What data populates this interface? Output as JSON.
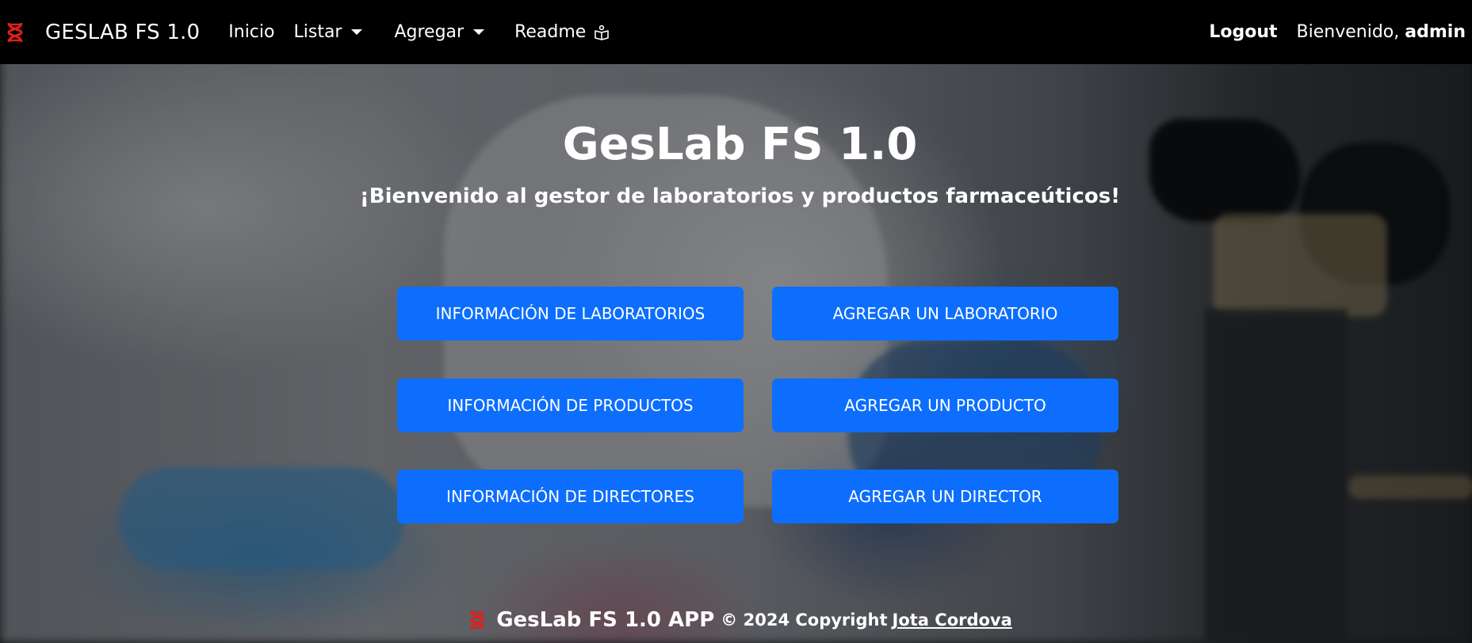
{
  "navbar": {
    "brand_icon": "dna-icon",
    "brand_title": "GESLAB FS 1.0",
    "items": {
      "inicio": "Inicio",
      "listar": "Listar",
      "agregar": "Agregar",
      "readme": "Readme"
    },
    "readme_icon": "book-icon",
    "logout": "Logout",
    "welcome_prefix": "Bienvenido,",
    "welcome_user": "admin"
  },
  "hero": {
    "title": "GesLab FS 1.0",
    "subtitle": "¡Bienvenido al gestor de laboratorios y productos farmaceúticos!"
  },
  "buttons": {
    "info_laboratorios": "INFORMACIÓN DE LABORATORIOS",
    "agregar_laboratorio": "AGREGAR UN LABORATORIO",
    "info_productos": "INFORMACIÓN DE PRODUCTOS",
    "agregar_producto": "AGREGAR UN PRODUCTO",
    "info_directores": "INFORMACIÓN DE DIRECTORES",
    "agregar_director": "AGREGAR UN DIRECTOR"
  },
  "footer": {
    "icon": "dna-icon",
    "app_name": "GesLab FS 1.0 APP",
    "copyright": "© 2024 Copyright",
    "author": "Jota Cordova"
  },
  "colors": {
    "navbar_bg": "#000000",
    "button_bg": "#0d6efd",
    "brand_icon": "#e0201b",
    "text": "#ffffff"
  }
}
